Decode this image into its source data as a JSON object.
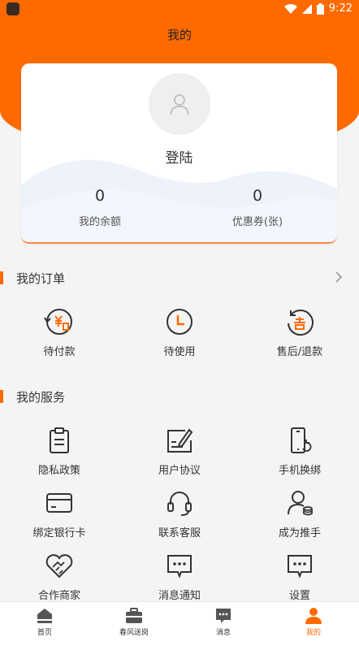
{
  "colors": {
    "accent": "#ff6a00",
    "background": "#f4f4f4"
  },
  "status_bar": {
    "time": "9:22",
    "battery": "8"
  },
  "header": {
    "title": "我的"
  },
  "profile": {
    "login_label": "登陆",
    "balance_value": "0",
    "balance_label": "我的余额",
    "coupon_value": "0",
    "coupon_label": "优惠券(张)"
  },
  "orders": {
    "title": "我的订单",
    "items": [
      {
        "label": "待付款",
        "icon": "pending-payment-icon"
      },
      {
        "label": "待使用",
        "icon": "clock-icon"
      },
      {
        "label": "售后/退款",
        "icon": "after-sale-icon"
      }
    ]
  },
  "services": {
    "title": "我的服务",
    "items": [
      {
        "label": "隐私政策",
        "icon": "clipboard-icon"
      },
      {
        "label": "用户协议",
        "icon": "edit-document-icon"
      },
      {
        "label": "手机换绑",
        "icon": "phone-rebind-icon"
      },
      {
        "label": "绑定银行卡",
        "icon": "bank-card-icon"
      },
      {
        "label": "联系客服",
        "icon": "headset-icon"
      },
      {
        "label": "成为推手",
        "icon": "promoter-icon"
      },
      {
        "label": "合作商家",
        "icon": "handshake-heart-icon"
      },
      {
        "label": "消息通知",
        "icon": "chat-icon"
      },
      {
        "label": "设置",
        "icon": "settings-chat-icon"
      }
    ]
  },
  "tabbar": {
    "items": [
      {
        "label": "首页",
        "icon": "home-icon"
      },
      {
        "label": "春风送岗",
        "icon": "briefcase-icon"
      },
      {
        "label": "消息",
        "icon": "message-icon"
      },
      {
        "label": "我的",
        "icon": "person-icon",
        "active": true
      }
    ]
  }
}
